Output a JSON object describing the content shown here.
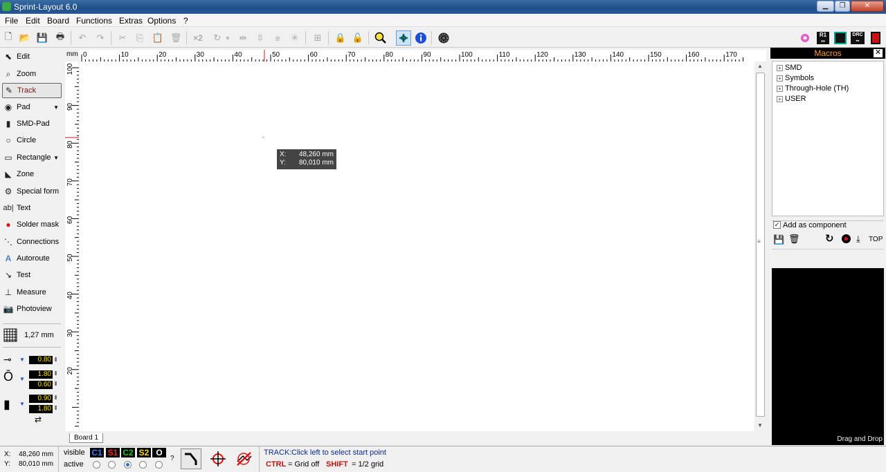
{
  "window": {
    "title": "Sprint-Layout 6.0",
    "min": "▁",
    "max": "❐",
    "close": "✕"
  },
  "menu": [
    "File",
    "Edit",
    "Board",
    "Functions",
    "Extras",
    "Options",
    "?"
  ],
  "toolbar": {
    "x2_label": "×2"
  },
  "tools": [
    {
      "label": "Edit",
      "icon": "cursor-icon"
    },
    {
      "label": "Zoom",
      "icon": "magnifier-icon"
    },
    {
      "label": "Track",
      "icon": "pencil-icon",
      "selected": true
    },
    {
      "label": "Pad",
      "icon": "pad-icon"
    },
    {
      "label": "SMD-Pad",
      "icon": "smd-pad-icon"
    },
    {
      "label": "Circle",
      "icon": "circle-icon"
    },
    {
      "label": "Rectangle",
      "icon": "rectangle-icon"
    },
    {
      "label": "Zone",
      "icon": "zone-icon"
    },
    {
      "label": "Special form",
      "icon": "special-form-icon"
    },
    {
      "label": "Text",
      "icon": "text-icon"
    },
    {
      "label": "Solder mask",
      "icon": "solder-mask-icon"
    },
    {
      "label": "Connections",
      "icon": "connections-icon"
    },
    {
      "label": "Autoroute",
      "icon": "autoroute-icon"
    },
    {
      "label": "Test",
      "icon": "test-icon"
    },
    {
      "label": "Measure",
      "icon": "measure-icon"
    },
    {
      "label": "Photoview",
      "icon": "camera-icon"
    }
  ],
  "grid": {
    "value": "1,27 mm"
  },
  "params": {
    "track_width": "0.80",
    "pad_outer": "1.80",
    "pad_inner": "0.60",
    "smd_w": "0.90",
    "smd_h": "1.80"
  },
  "ruler": {
    "unit": "mm",
    "h_ticks": [
      "0",
      "10",
      "20",
      "30",
      "40",
      "50",
      "60",
      "70",
      "80",
      "90",
      "100",
      "110",
      "120",
      "130",
      "140",
      "150",
      "160",
      "170"
    ],
    "v_ticks": [
      "100",
      "90",
      "80",
      "70",
      "60",
      "50",
      "40",
      "30",
      "20"
    ]
  },
  "board": {
    "tab": "Board 1"
  },
  "coord_tooltip": {
    "x_label": "X:",
    "x": "48,260 mm",
    "y_label": "Y:",
    "y": "80,010 mm"
  },
  "macros": {
    "title": "Macros",
    "close": "✕",
    "tree": [
      "SMD",
      "Symbols",
      "Through-Hole (TH)",
      "USER"
    ],
    "add_as_component": "Add as component",
    "top_label": "TOP",
    "drag_drop": "Drag and Drop"
  },
  "status": {
    "x_label": "X:",
    "x": "48,260 mm",
    "y_label": "Y:",
    "y": "80,010 mm",
    "visible": "visible",
    "active": "active",
    "layers": [
      {
        "name": "C1",
        "color": "#3a7bff"
      },
      {
        "name": "S1",
        "color": "#ff2020"
      },
      {
        "name": "C2",
        "color": "#28c828"
      },
      {
        "name": "S2",
        "color": "#ffe000"
      },
      {
        "name": "O",
        "color": "#ffffff"
      }
    ],
    "active_layer_index": 2,
    "question": "?",
    "mode": "TRACK:",
    "hint": "Click left to select start point",
    "ctrl_key": "CTRL",
    "ctrl_hint": "= Grid off",
    "shift_key": "SHIFT",
    "shift_hint": "= 1/2 grid"
  }
}
